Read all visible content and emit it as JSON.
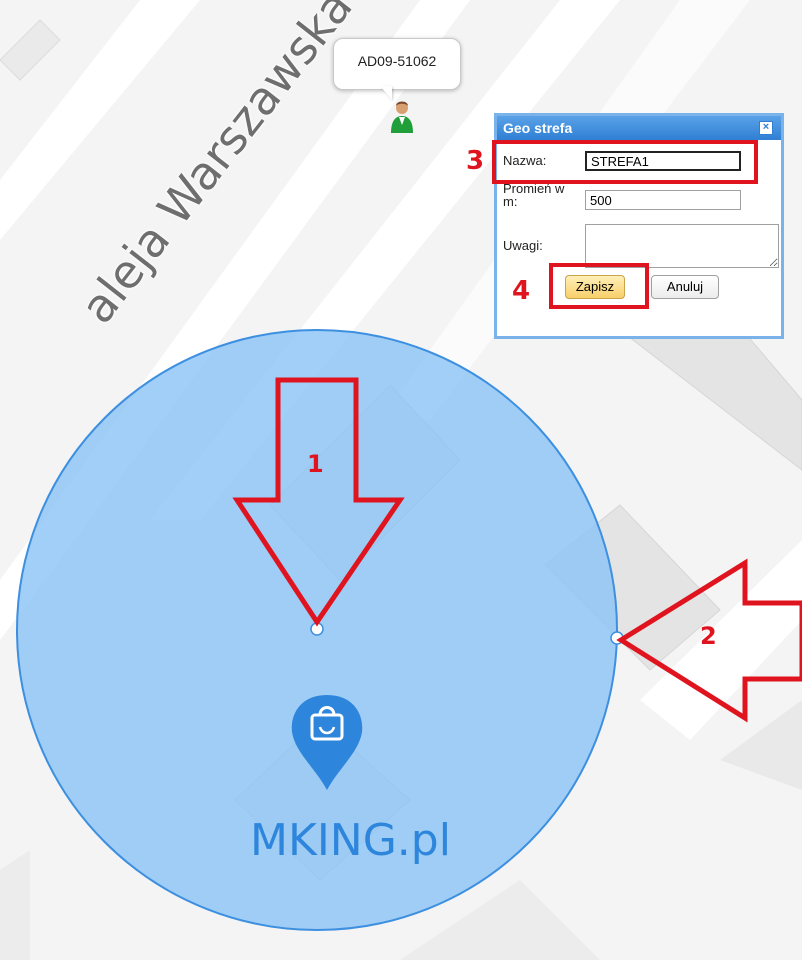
{
  "map": {
    "street_name": "aleja Warszawska",
    "vehicle_label": "AD09-51062",
    "watermark": "MKING.pl",
    "circle_fill": "#8cc4f5",
    "circle_stroke": "#3d8fe0"
  },
  "dialog": {
    "title": "Geo strefa",
    "close_icon": "close-icon",
    "name_label": "Nazwa:",
    "name_value": "STREFA1",
    "radius_label": "Promień w m:",
    "radius_value": "500",
    "notes_label": "Uwagi:",
    "notes_value": "",
    "save_label": "Zapisz",
    "cancel_label": "Anuluj"
  },
  "annotations": {
    "arrow_1": "1",
    "arrow_2": "2",
    "box_3": "3",
    "box_4": "4",
    "color": "#e0141e"
  }
}
